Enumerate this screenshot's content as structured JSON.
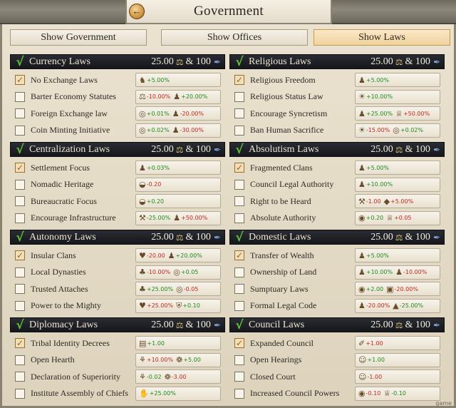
{
  "window": {
    "title": "Government"
  },
  "tabs": [
    {
      "label": "Show Government",
      "active": false
    },
    {
      "label": "Show Offices",
      "active": false
    },
    {
      "label": "Show Laws",
      "active": true
    }
  ],
  "panels": [
    {
      "name": "Currency Laws",
      "cost_a": "25.00",
      "cost_b": "& 100",
      "rows": [
        {
          "label": "No Exchange Laws",
          "checked": true,
          "effects": [
            {
              "icon": "horse-icon",
              "value": "+5.00%",
              "positive": true
            }
          ]
        },
        {
          "label": "Barter Economy Statutes",
          "checked": false,
          "effects": [
            {
              "icon": "trade-icon",
              "value": "-10.00%",
              "positive": false
            },
            {
              "icon": "people-icon",
              "value": "+20.00%",
              "positive": true
            }
          ]
        },
        {
          "label": "Foreign Exchange law",
          "checked": false,
          "effects": [
            {
              "icon": "coins-icon",
              "value": "+0.01%",
              "positive": true
            },
            {
              "icon": "people-icon",
              "value": "-20.00%",
              "positive": false
            }
          ]
        },
        {
          "label": "Coin Minting Initiative",
          "checked": false,
          "effects": [
            {
              "icon": "coins-icon",
              "value": "+0.02%",
              "positive": true
            },
            {
              "icon": "people-icon",
              "value": "-30.00%",
              "positive": false
            }
          ]
        }
      ]
    },
    {
      "name": "Religious Laws",
      "cost_a": "25.00",
      "cost_b": "& 100",
      "rows": [
        {
          "label": "Religious Freedom",
          "checked": true,
          "effects": [
            {
              "icon": "people-icon",
              "value": "+5.00%",
              "positive": true
            }
          ]
        },
        {
          "label": "Religious Status Law",
          "checked": false,
          "effects": [
            {
              "icon": "sun-icon",
              "value": "+10.00%",
              "positive": true
            }
          ]
        },
        {
          "label": "Encourage Syncretism",
          "checked": false,
          "effects": [
            {
              "icon": "people-icon",
              "value": "+25.00%",
              "positive": true
            },
            {
              "icon": "crown-icon",
              "value": "+50.00%",
              "positive": false
            }
          ]
        },
        {
          "label": "Ban Human Sacrifice",
          "checked": false,
          "effects": [
            {
              "icon": "sun-icon",
              "value": "-15.00%",
              "positive": false
            },
            {
              "icon": "coins-icon",
              "value": "+0.02%",
              "positive": true
            }
          ]
        }
      ]
    },
    {
      "name": "Centralization Laws",
      "cost_a": "25.00",
      "cost_b": "& 100",
      "rows": [
        {
          "label": "Settlement Focus",
          "checked": true,
          "effects": [
            {
              "icon": "people-icon",
              "value": "+0.03%",
              "positive": true
            }
          ]
        },
        {
          "label": "Nomadic Heritage",
          "checked": false,
          "effects": [
            {
              "icon": "bread-icon",
              "value": "-0.20",
              "positive": false
            }
          ]
        },
        {
          "label": "Bureaucratic Focus",
          "checked": false,
          "effects": [
            {
              "icon": "bread-icon",
              "value": "+0.20",
              "positive": true
            }
          ]
        },
        {
          "label": "Encourage Infrastructure",
          "checked": false,
          "effects": [
            {
              "icon": "tools-icon",
              "value": "-25.00%",
              "positive": true
            },
            {
              "icon": "people-icon",
              "value": "+50.00%",
              "positive": false
            }
          ]
        }
      ]
    },
    {
      "name": "Absolutism Laws",
      "cost_a": "25.00",
      "cost_b": "& 100",
      "rows": [
        {
          "label": "Fragmented Clans",
          "checked": true,
          "effects": [
            {
              "icon": "people-icon",
              "value": "+5.00%",
              "positive": true
            }
          ]
        },
        {
          "label": "Council Legal Authority",
          "checked": false,
          "effects": [
            {
              "icon": "people-icon",
              "value": "+10.00%",
              "positive": true
            }
          ]
        },
        {
          "label": "Right to be Heard",
          "checked": false,
          "effects": [
            {
              "icon": "hammer-icon",
              "value": "-1.00",
              "positive": false
            },
            {
              "icon": "gems-icon",
              "value": "+5.00%",
              "positive": false
            }
          ]
        },
        {
          "label": "Absolute Authority",
          "checked": false,
          "effects": [
            {
              "icon": "gold-icon",
              "value": "+0.20",
              "positive": true
            },
            {
              "icon": "crown-icon",
              "value": "+0.05",
              "positive": false
            }
          ]
        }
      ]
    },
    {
      "name": "Autonomy Laws",
      "cost_a": "25.00",
      "cost_b": "& 100",
      "rows": [
        {
          "label": "Insular Clans",
          "checked": true,
          "effects": [
            {
              "icon": "heart-icon",
              "value": "-20.00",
              "positive": false
            },
            {
              "icon": "people-icon",
              "value": "+20.00%",
              "positive": true
            }
          ]
        },
        {
          "label": "Local Dynasties",
          "checked": false,
          "effects": [
            {
              "icon": "tree-icon",
              "value": "-10.00%",
              "positive": false
            },
            {
              "icon": "coins-icon",
              "value": "+0.05",
              "positive": true
            }
          ]
        },
        {
          "label": "Trusted Attaches",
          "checked": false,
          "effects": [
            {
              "icon": "tree-icon",
              "value": "+25.00%",
              "positive": true
            },
            {
              "icon": "coins-icon",
              "value": "-0.05",
              "positive": false
            }
          ]
        },
        {
          "label": "Power to the Mighty",
          "checked": false,
          "effects": [
            {
              "icon": "heart-icon",
              "value": "+25.00%",
              "positive": false
            },
            {
              "icon": "shield-icon",
              "value": "+0.10",
              "positive": true
            }
          ]
        }
      ]
    },
    {
      "name": "Domestic Laws",
      "cost_a": "25.00",
      "cost_b": "& 100",
      "rows": [
        {
          "label": "Transfer of Wealth",
          "checked": true,
          "effects": [
            {
              "icon": "people-icon",
              "value": "+5.00%",
              "positive": true
            }
          ]
        },
        {
          "label": "Ownership of Land",
          "checked": false,
          "effects": [
            {
              "icon": "people-icon",
              "value": "+10.00%",
              "positive": true
            },
            {
              "icon": "people-icon",
              "value": "-10.00%",
              "positive": false
            }
          ]
        },
        {
          "label": "Sumptuary Laws",
          "checked": false,
          "effects": [
            {
              "icon": "gold-icon",
              "value": "+2.00",
              "positive": true
            },
            {
              "icon": "chest-icon",
              "value": "-20.00%",
              "positive": false
            }
          ]
        },
        {
          "label": "Formal Legal Code",
          "checked": false,
          "effects": [
            {
              "icon": "people-icon",
              "value": "-20.00%",
              "positive": false
            },
            {
              "icon": "monument-icon",
              "value": "-25.00%",
              "positive": true
            }
          ]
        }
      ]
    },
    {
      "name": "Diplomacy Laws",
      "cost_a": "25.00",
      "cost_b": "& 100",
      "rows": [
        {
          "label": "Tribal Identity Decrees",
          "checked": true,
          "effects": [
            {
              "icon": "card-icon",
              "value": "+1.00",
              "positive": true
            }
          ]
        },
        {
          "label": "Open Hearth",
          "checked": false,
          "effects": [
            {
              "icon": "plant-icon",
              "value": "+10.00%",
              "positive": false
            },
            {
              "icon": "brain-icon",
              "value": "+5.00",
              "positive": true
            }
          ]
        },
        {
          "label": "Declaration of Superiority",
          "checked": false,
          "effects": [
            {
              "icon": "plant-icon",
              "value": "-0.02",
              "positive": true
            },
            {
              "icon": "brain-icon",
              "value": "-3.00",
              "positive": false
            }
          ]
        },
        {
          "label": "Institute Assembly of Chiefs",
          "checked": false,
          "effects": [
            {
              "icon": "hand-icon",
              "value": "+25.00%",
              "positive": true
            }
          ]
        }
      ]
    },
    {
      "name": "Council Laws",
      "cost_a": "25.00",
      "cost_b": "& 100",
      "rows": [
        {
          "label": "Expanded Council",
          "checked": true,
          "effects": [
            {
              "icon": "scroll-icon",
              "value": "+1.00",
              "positive": false
            }
          ]
        },
        {
          "label": "Open Hearings",
          "checked": false,
          "effects": [
            {
              "icon": "portrait-icon",
              "value": "+1.00",
              "positive": true
            }
          ]
        },
        {
          "label": "Closed Court",
          "checked": false,
          "effects": [
            {
              "icon": "portrait-icon",
              "value": "-1.00",
              "positive": false
            }
          ]
        },
        {
          "label": "Increased Council Powers",
          "checked": false,
          "effects": [
            {
              "icon": "gold-icon",
              "value": "-0.10",
              "positive": false
            },
            {
              "icon": "crown-icon",
              "value": "-0.10",
              "positive": true
            }
          ]
        }
      ]
    }
  ],
  "footer": {
    "watermark": "game"
  }
}
